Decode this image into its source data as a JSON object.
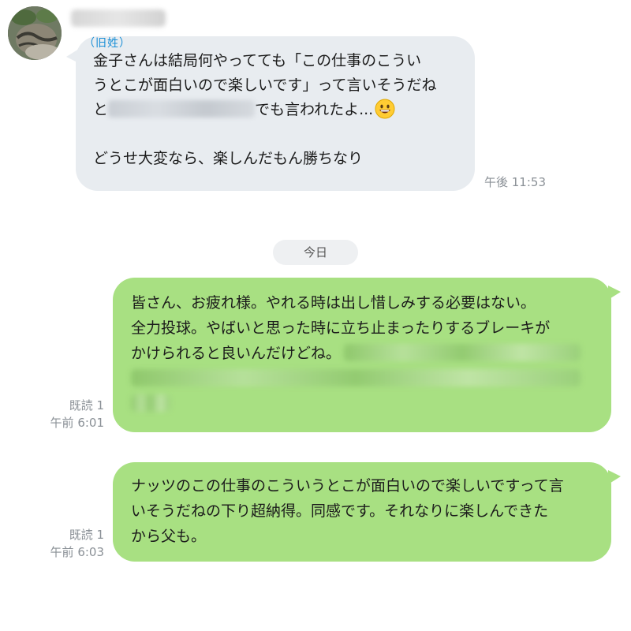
{
  "incoming": {
    "old_name_tag": "（旧姓）",
    "lines": [
      "金子さんは結局何やってても「この仕事のこうい",
      "うとこが面白いので楽しいです」って言いそうだね",
      "と",
      "でも言われたよ...",
      "",
      "どうせ大変なら、楽しんだもん勝ちなり"
    ],
    "emoji": "grinning-face-emoji",
    "time": "午後 11:53"
  },
  "date_separator": "今日",
  "outgoing": [
    {
      "lines": [
        "皆さん、お疲れ様。やれる時は出し惜しみする必要はない。",
        "全力投球。やばいと思った時に立ち止まったりするブレーキが",
        "かけられると良いんだけどね。"
      ],
      "read": "既読 1",
      "time": "午前 6:01"
    },
    {
      "lines": [
        "ナッツのこの仕事のこういうとこが面白いので楽しいですって言",
        "いそうだねの下り超納得。同感です。それなりに楽しんできた",
        "から父も。"
      ],
      "read": "既読 1",
      "time": "午前 6:03"
    }
  ],
  "colors": {
    "incoming_bubble": "#e8ecf0",
    "outgoing_bubble": "#a8e082",
    "name_tag": "#1a8fd6",
    "meta_text": "#8a9096"
  }
}
